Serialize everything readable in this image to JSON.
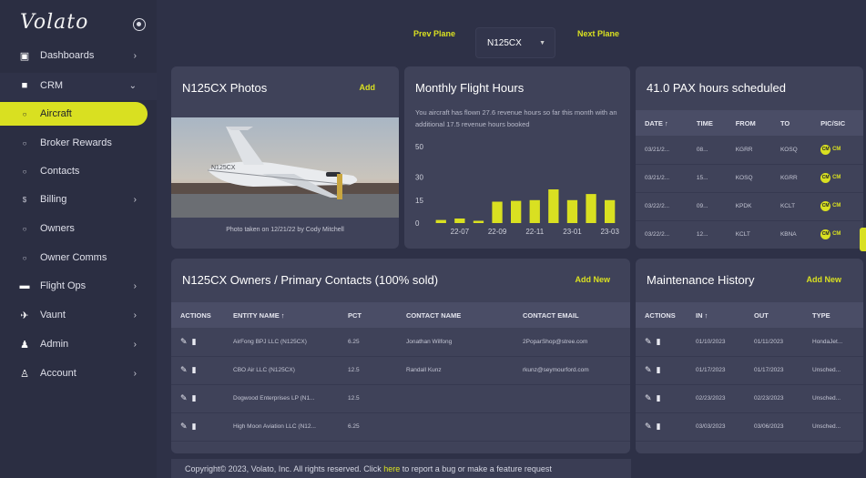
{
  "app": {
    "logo": "Volato"
  },
  "sidebar": {
    "items": [
      {
        "label": "Dashboards",
        "icon": "monitor-icon",
        "chevron": "›"
      },
      {
        "label": "CRM",
        "icon": "building-icon",
        "chevron": "⌄"
      },
      {
        "label": "Aircraft",
        "icon": "circle-icon"
      },
      {
        "label": "Broker Rewards",
        "icon": "circle-icon"
      },
      {
        "label": "Contacts",
        "icon": "circle-icon"
      },
      {
        "label": "Billing",
        "icon": "dollar-icon",
        "chevron": "›"
      },
      {
        "label": "Owners",
        "icon": "circle-icon"
      },
      {
        "label": "Owner Comms",
        "icon": "circle-icon"
      },
      {
        "label": "Flight Ops",
        "icon": "briefcase-icon",
        "chevron": "›"
      },
      {
        "label": "Vaunt",
        "icon": "plane-icon",
        "chevron": "›"
      },
      {
        "label": "Admin",
        "icon": "users-icon",
        "chevron": "›"
      },
      {
        "label": "Account",
        "icon": "person-icon",
        "chevron": "›"
      }
    ]
  },
  "plane_selector": {
    "prev_label": "Prev Plane",
    "next_label": "Next Plane",
    "selected": "N125CX"
  },
  "photos": {
    "title": "N125CX Photos",
    "add_label": "Add",
    "caption": "Photo taken on 12/21/22 by Cody Mitchell",
    "tail_text": "N125CX"
  },
  "flight_hours": {
    "title": "Monthly Flight Hours",
    "description": "You aircraft has flown 27.6 revenue hours so far this month with an additional 17.5 revenue hours booked"
  },
  "chart_data": {
    "type": "bar",
    "categories": [
      "22-06",
      "22-07",
      "22-08",
      "22-09",
      "22-10",
      "22-11",
      "22-12",
      "23-01",
      "23-02",
      "23-03"
    ],
    "series": [
      {
        "values": [
          2,
          3,
          1.5,
          14,
          14.5,
          15,
          22,
          15,
          19,
          15
        ]
      }
    ],
    "y_ticks": [
      "0",
      "15",
      "30",
      "50"
    ],
    "x_ticks": [
      "22-07",
      "22-09",
      "22-11",
      "23-01",
      "23-03"
    ],
    "ylim": [
      0,
      50
    ],
    "colors": {
      "bar": "#d9e021"
    }
  },
  "pax": {
    "title": "41.0 PAX hours scheduled",
    "headers": [
      "DATE ↑",
      "TIME",
      "FROM",
      "TO",
      "PIC/SIC"
    ],
    "rows": [
      {
        "date": "03/21/2...",
        "time": "08...",
        "from": "KGRR",
        "to": "KOSQ",
        "pic": "CM",
        "sic": "CM"
      },
      {
        "date": "03/21/2...",
        "time": "15...",
        "from": "KOSQ",
        "to": "KGRR",
        "pic": "CM",
        "sic": "CM"
      },
      {
        "date": "03/22/2...",
        "time": "09...",
        "from": "KPDK",
        "to": "KCLT",
        "pic": "CM",
        "sic": "CM"
      },
      {
        "date": "03/22/2...",
        "time": "12...",
        "from": "KCLT",
        "to": "KBNA",
        "pic": "CM",
        "sic": "CM"
      }
    ]
  },
  "owners": {
    "title": "N125CX Owners / Primary Contacts (100% sold)",
    "add_label": "Add New",
    "headers": [
      "ACTIONS",
      "ENTITY NAME ↑",
      "PCT",
      "CONTACT NAME",
      "CONTACT EMAIL"
    ],
    "rows": [
      {
        "entity": "AirFong BPJ LLC (N125CX)",
        "pct": "6.25",
        "contact": "Jonathan Wilfong",
        "email": "2PoparShop@stree.com"
      },
      {
        "entity": "CBO Air LLC (N125CX)",
        "pct": "12.5",
        "contact": "Randall Kunz",
        "email": "rkunz@seymourford.com"
      },
      {
        "entity": "Dogwood Enterprises LP (N1...",
        "pct": "12.5",
        "contact": "",
        "email": ""
      },
      {
        "entity": "High Moon Aviation LLC (N12...",
        "pct": "6.25",
        "contact": "",
        "email": ""
      }
    ]
  },
  "maintenance": {
    "title": "Maintenance History",
    "add_label": "Add New",
    "headers": [
      "ACTIONS",
      "IN ↑",
      "OUT",
      "TYPE"
    ],
    "rows": [
      {
        "in": "01/10/2023",
        "out": "01/11/2023",
        "type": "HondaJet..."
      },
      {
        "in": "01/17/2023",
        "out": "01/17/2023",
        "type": "Unsched..."
      },
      {
        "in": "02/23/2023",
        "out": "02/23/2023",
        "type": "Unsched..."
      },
      {
        "in": "03/03/2023",
        "out": "03/06/2023",
        "type": "Unsched..."
      }
    ]
  },
  "footer": {
    "pre": "Copyright© 2023, Volato, Inc. All rights reserved. Click ",
    "link": "here",
    "post": " to report a bug or make a feature request"
  },
  "colors": {
    "accent": "#d9e021",
    "card": "#3f4259",
    "background": "#2e3147"
  }
}
